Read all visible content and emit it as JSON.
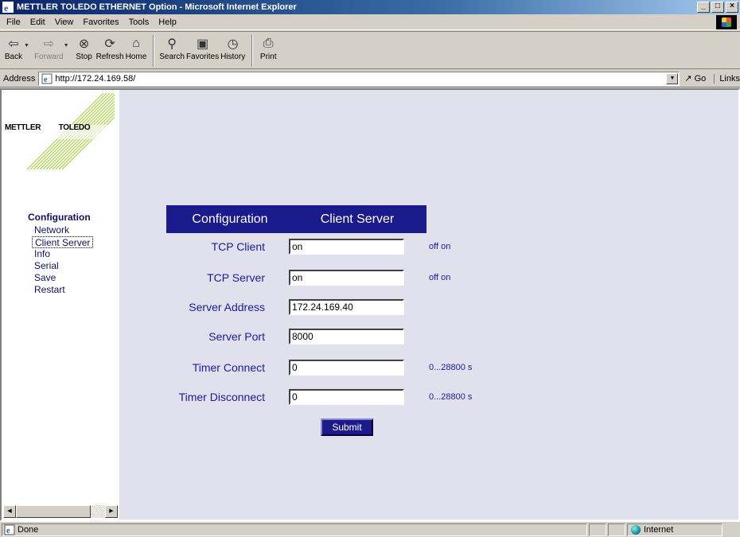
{
  "window": {
    "title": "METTLER TOLEDO ETHERNET Option - Microsoft Internet Explorer"
  },
  "menu": {
    "items": [
      "File",
      "Edit",
      "View",
      "Favorites",
      "Tools",
      "Help"
    ]
  },
  "toolbar": {
    "back": "Back",
    "forward": "Forward",
    "stop": "Stop",
    "refresh": "Refresh",
    "home": "Home",
    "search": "Search",
    "favorites": "Favorites",
    "history": "History",
    "print": "Print"
  },
  "address": {
    "label": "Address",
    "url": "http://172.24.169.58/",
    "go": "Go",
    "links": "Links"
  },
  "logo": {
    "word1": "METTLER",
    "word2": "TOLEDO"
  },
  "nav": {
    "title": "Configuration",
    "items": [
      "Network",
      "Client Server",
      "Info",
      "Serial",
      "Save",
      "Restart"
    ]
  },
  "form": {
    "header_left": "Configuration",
    "header_right": "Client Server",
    "rows": [
      {
        "label": "TCP Client",
        "value": "on",
        "hint": "off on"
      },
      {
        "label": "TCP Server",
        "value": "on",
        "hint": "off on"
      },
      {
        "label": "Server Address",
        "value": "172.24.169.40",
        "hint": ""
      },
      {
        "label": "Server Port",
        "value": "8000",
        "hint": ""
      },
      {
        "label": "Timer Connect",
        "value": "0",
        "hint": "0...28800 s"
      },
      {
        "label": "Timer Disconnect",
        "value": "0",
        "hint": "0...28800 s"
      }
    ],
    "submit": "Submit"
  },
  "status": {
    "text": "Done",
    "zone": "Internet"
  }
}
